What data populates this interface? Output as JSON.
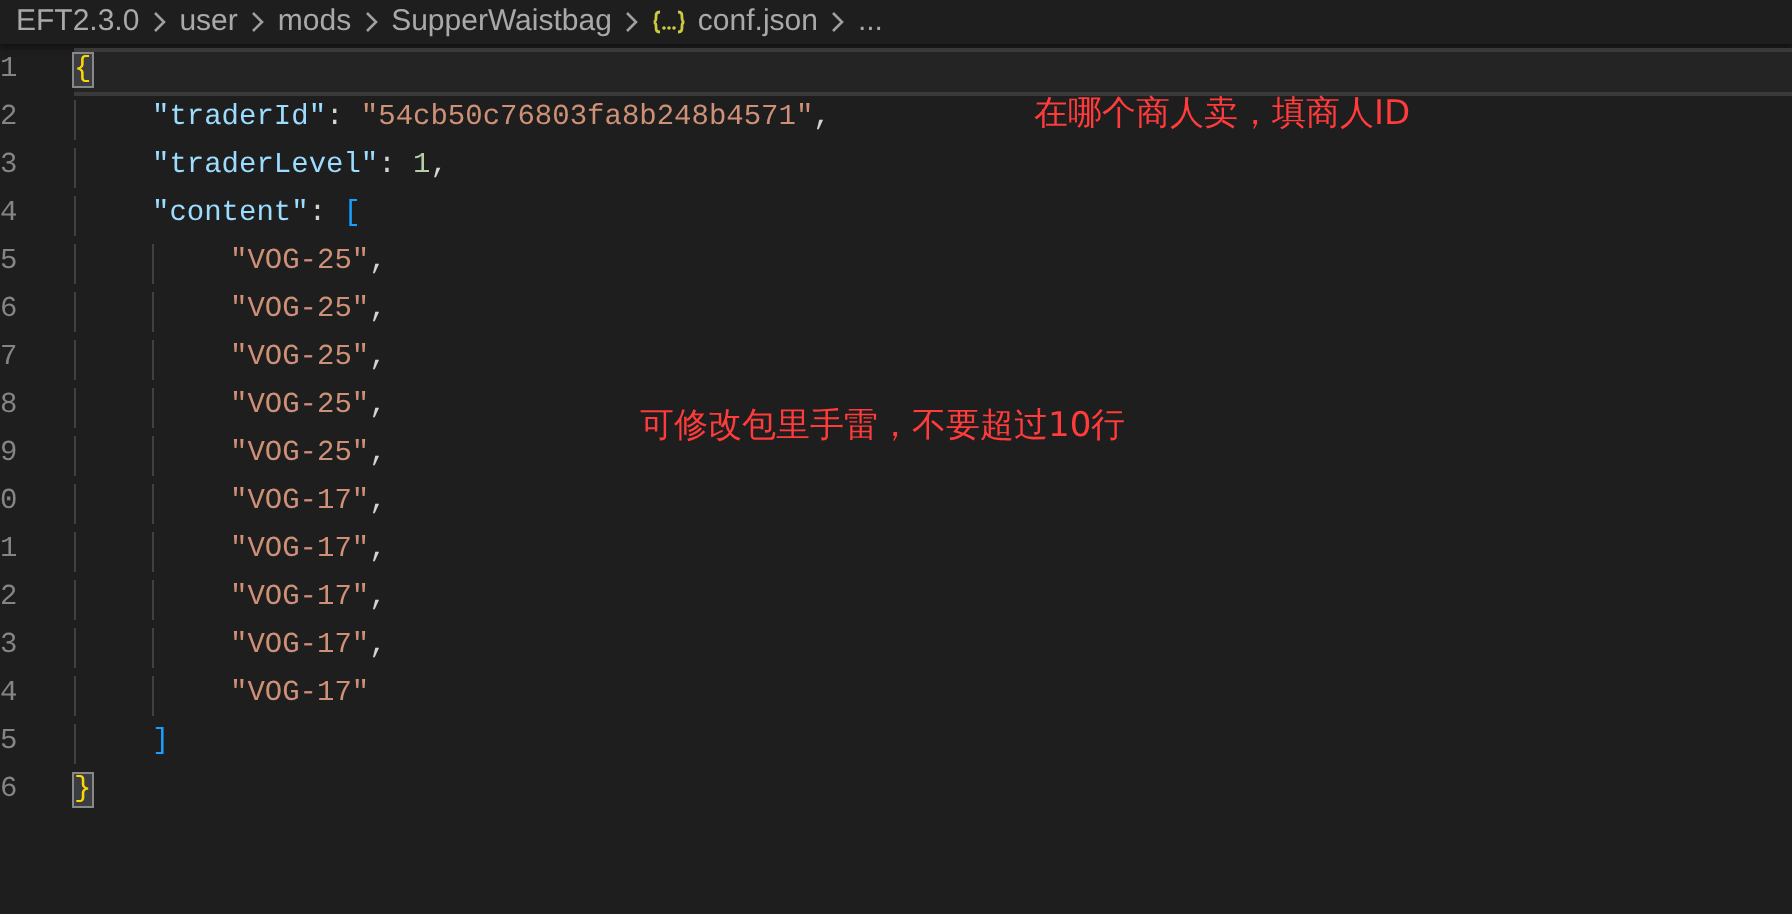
{
  "breadcrumb": [
    {
      "kind": "folder",
      "text": "EFT2.3.0"
    },
    {
      "kind": "folder",
      "text": "user"
    },
    {
      "kind": "folder",
      "text": "mods"
    },
    {
      "kind": "folder",
      "text": "SupperWaistbag"
    },
    {
      "kind": "json",
      "text": "conf.json"
    },
    {
      "kind": "more",
      "text": "..."
    }
  ],
  "lines": [
    {
      "number": "1",
      "current": true,
      "tokens": [
        {
          "kind": "bracket",
          "text": "{",
          "matched": true
        }
      ],
      "children": [
        {
          "number": "2",
          "current": false,
          "tokens": [
            {
              "kind": "key",
              "text": "\"traderId\""
            },
            {
              "kind": "punct",
              "text": ": "
            },
            {
              "kind": "string",
              "text": "\"54cb50c76803fa8b248b4571\""
            },
            {
              "kind": "punct",
              "text": ","
            }
          ]
        },
        {
          "number": "3",
          "current": false,
          "tokens": [
            {
              "kind": "key",
              "text": "\"traderLevel\""
            },
            {
              "kind": "punct",
              "text": ": "
            },
            {
              "kind": "number",
              "text": "1"
            },
            {
              "kind": "punct",
              "text": ","
            }
          ]
        },
        {
          "number": "4",
          "current": false,
          "tokens": [
            {
              "kind": "key",
              "text": "\"content\""
            },
            {
              "kind": "punct",
              "text": ": "
            },
            {
              "kind": "bracket",
              "text": "[",
              "matched": false
            }
          ],
          "children": [
            {
              "number": "5",
              "current": false,
              "tokens": [
                {
                  "kind": "string",
                  "text": "\"VOG-25\""
                },
                {
                  "kind": "punct",
                  "text": ","
                }
              ]
            },
            {
              "number": "6",
              "current": false,
              "tokens": [
                {
                  "kind": "string",
                  "text": "\"VOG-25\""
                },
                {
                  "kind": "punct",
                  "text": ","
                }
              ]
            },
            {
              "number": "7",
              "current": false,
              "tokens": [
                {
                  "kind": "string",
                  "text": "\"VOG-25\""
                },
                {
                  "kind": "punct",
                  "text": ","
                }
              ]
            },
            {
              "number": "8",
              "current": false,
              "tokens": [
                {
                  "kind": "string",
                  "text": "\"VOG-25\""
                },
                {
                  "kind": "punct",
                  "text": ","
                }
              ]
            },
            {
              "number": "9",
              "current": false,
              "tokens": [
                {
                  "kind": "string",
                  "text": "\"VOG-25\""
                },
                {
                  "kind": "punct",
                  "text": ","
                }
              ]
            },
            {
              "number": "0",
              "current": false,
              "tokens": [
                {
                  "kind": "string",
                  "text": "\"VOG-17\""
                },
                {
                  "kind": "punct",
                  "text": ","
                }
              ]
            },
            {
              "number": "1",
              "current": false,
              "tokens": [
                {
                  "kind": "string",
                  "text": "\"VOG-17\""
                },
                {
                  "kind": "punct",
                  "text": ","
                }
              ]
            },
            {
              "number": "2",
              "current": false,
              "tokens": [
                {
                  "kind": "string",
                  "text": "\"VOG-17\""
                },
                {
                  "kind": "punct",
                  "text": ","
                }
              ]
            },
            {
              "number": "3",
              "current": false,
              "tokens": [
                {
                  "kind": "string",
                  "text": "\"VOG-17\""
                },
                {
                  "kind": "punct",
                  "text": ","
                }
              ]
            },
            {
              "number": "4",
              "current": false,
              "tokens": [
                {
                  "kind": "string",
                  "text": "\"VOG-17\""
                }
              ]
            }
          ]
        },
        {
          "number": "5",
          "current": false,
          "tokens": [
            {
              "kind": "bracket",
              "text": "]",
              "matched": false
            }
          ]
        }
      ]
    },
    {
      "number": "6",
      "current": false,
      "tokens": [
        {
          "kind": "bracket",
          "text": "}",
          "matched": true
        }
      ]
    }
  ],
  "annotations": [
    {
      "text": "在哪个商人卖，填商人ID"
    },
    {
      "text": "可修改包里手雷，不要超过10行"
    }
  ]
}
